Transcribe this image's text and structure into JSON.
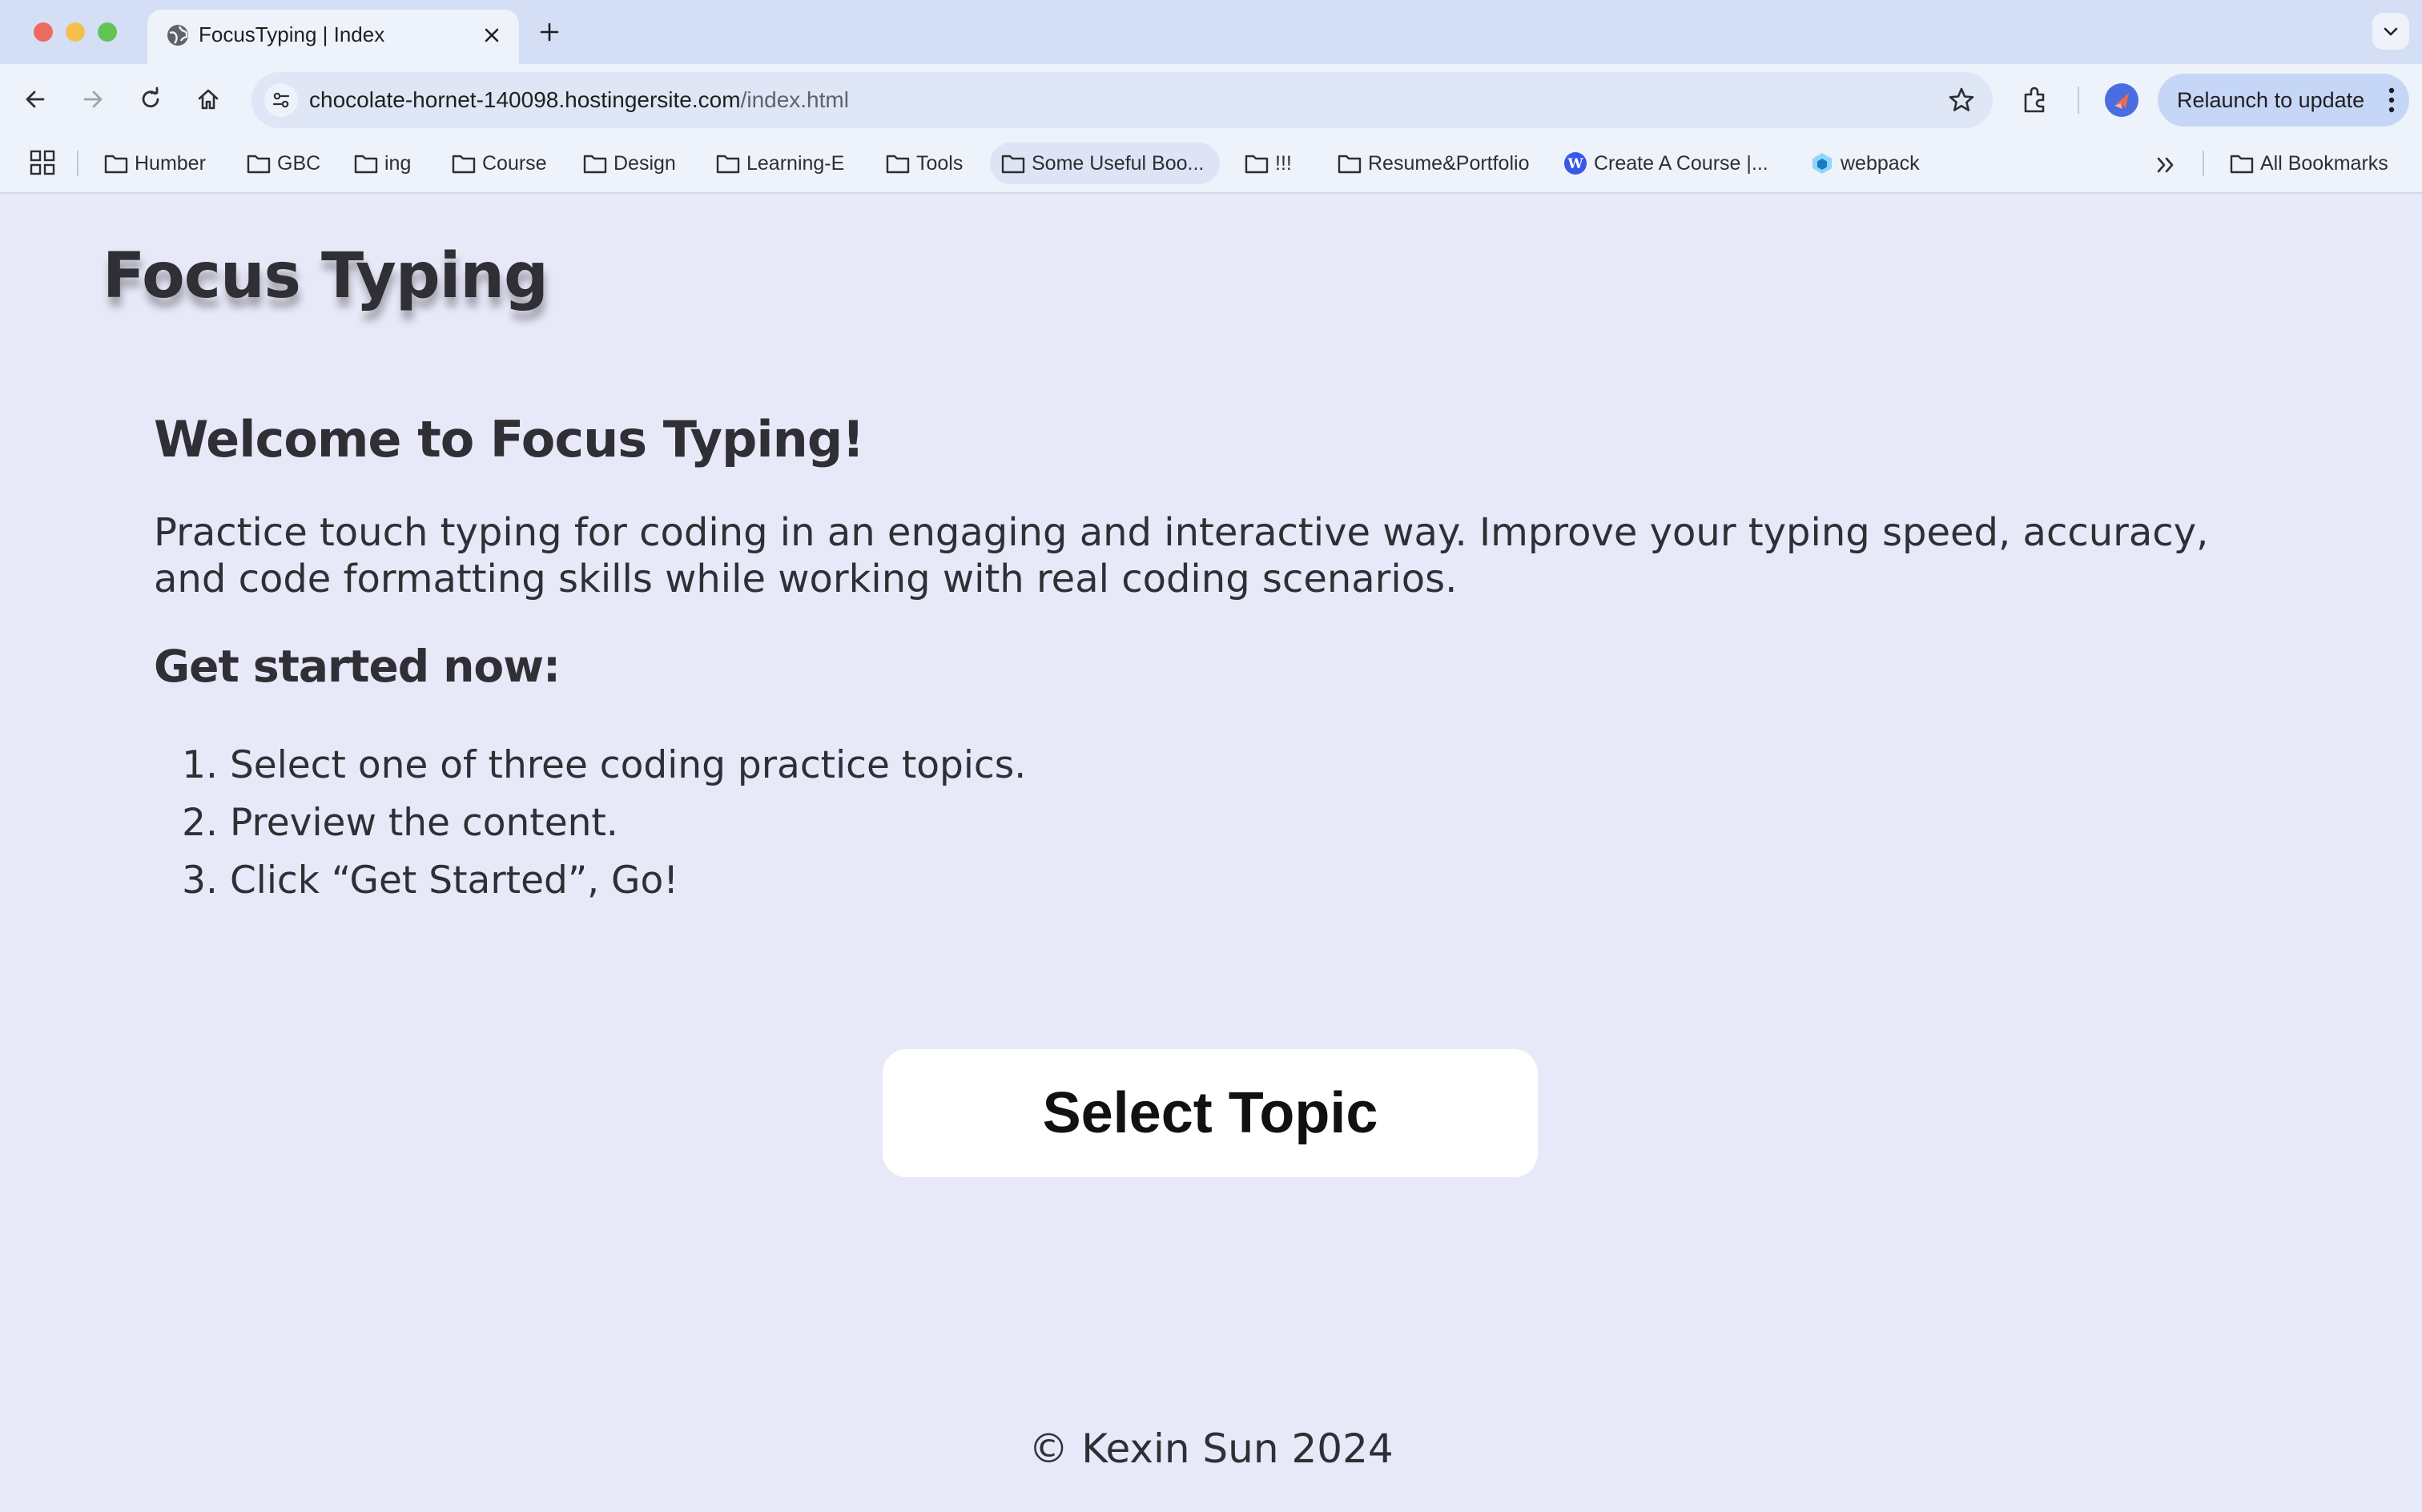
{
  "browser": {
    "tab": {
      "title": "FocusTyping | Index"
    },
    "omnibox": {
      "url_host": "chocolate-hornet-140098.hostingersite.com",
      "url_path": "/index.html"
    },
    "relaunch_label": "Relaunch to update",
    "bookmarks": [
      {
        "label": "Humber",
        "icon": "folder-icon"
      },
      {
        "label": "GBC",
        "icon": "folder-icon"
      },
      {
        "label": "ing",
        "icon": "folder-icon"
      },
      {
        "label": "Course",
        "icon": "folder-icon"
      },
      {
        "label": "Design",
        "icon": "folder-icon"
      },
      {
        "label": "Learning-E",
        "icon": "folder-icon"
      },
      {
        "label": "Tools",
        "icon": "folder-icon"
      },
      {
        "label": "Some Useful Boo...",
        "icon": "folder-icon"
      },
      {
        "label": "!!!",
        "icon": "folder-icon"
      },
      {
        "label": "Resume&Portfolio",
        "icon": "folder-icon"
      },
      {
        "label": "Create A Course |...",
        "icon": "wordpress-icon"
      },
      {
        "label": "webpack",
        "icon": "webpack-icon"
      }
    ],
    "all_bookmarks": "All Bookmarks"
  },
  "page": {
    "site_title": "Focus Typing",
    "welcome_heading": "Welcome to Focus Typing!",
    "intro": "Practice touch typing for coding in an engaging and interactive way. Improve your typing speed, accuracy, and code formatting skills while working with real coding scenarios.",
    "started_heading": "Get started now:",
    "steps": [
      {
        "num": "1.",
        "text": "Select one of three coding practice topics."
      },
      {
        "num": "2.",
        "text": "Preview the content."
      },
      {
        "num": "3.",
        "text": "Click “Get Started”, Go!"
      }
    ],
    "select_button": "Select Topic",
    "footer": "© Kexin Sun 2024"
  },
  "colors": {
    "page_background": "#e8e9f8",
    "text": "#2f2f35",
    "button_background": "#ffffff",
    "relaunch_background": "#c6d6f7"
  }
}
